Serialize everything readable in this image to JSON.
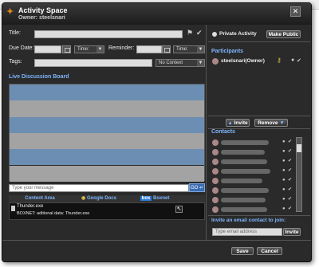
{
  "window": {
    "title": "Activity Space",
    "owner": "Owner: steelsnari"
  },
  "form": {
    "title_label": "Title:",
    "due_date_label": "Due Date:",
    "time_label": "Time:",
    "reminder_label": "Reminder:",
    "tags_label": "Tags:",
    "context_value": "No Context"
  },
  "board": {
    "header": "Live Discussion Board",
    "message_placeholder": "Type your message",
    "send_label": "GO"
  },
  "tabs": [
    {
      "label": "Content Area"
    },
    {
      "label": "Google Docs"
    },
    {
      "label": "Boxnet"
    }
  ],
  "content": {
    "file_name": "Thunder.exe",
    "file_meta": "BOXNET: aditional data: Thunder.exe"
  },
  "right_panel": {
    "private_activity_label": "Private Activity",
    "make_public_label": "Make Public",
    "participants_header": "Participants",
    "participant_name": "steelsnari(Owner)",
    "invite_label": "Invite",
    "remove_label": "Remove",
    "contacts_header": "Contacts",
    "invite_email_header": "Invite an email contact to join:",
    "email_placeholder": "Type email address",
    "invite_button_label": "Invite"
  },
  "footer": {
    "save_label": "Save",
    "cancel_label": "Cancel"
  },
  "colors": {
    "accent": "#7eb6ff",
    "stripe_blue": "#6d8eb3",
    "stripe_gray": "#a3a3a3"
  }
}
